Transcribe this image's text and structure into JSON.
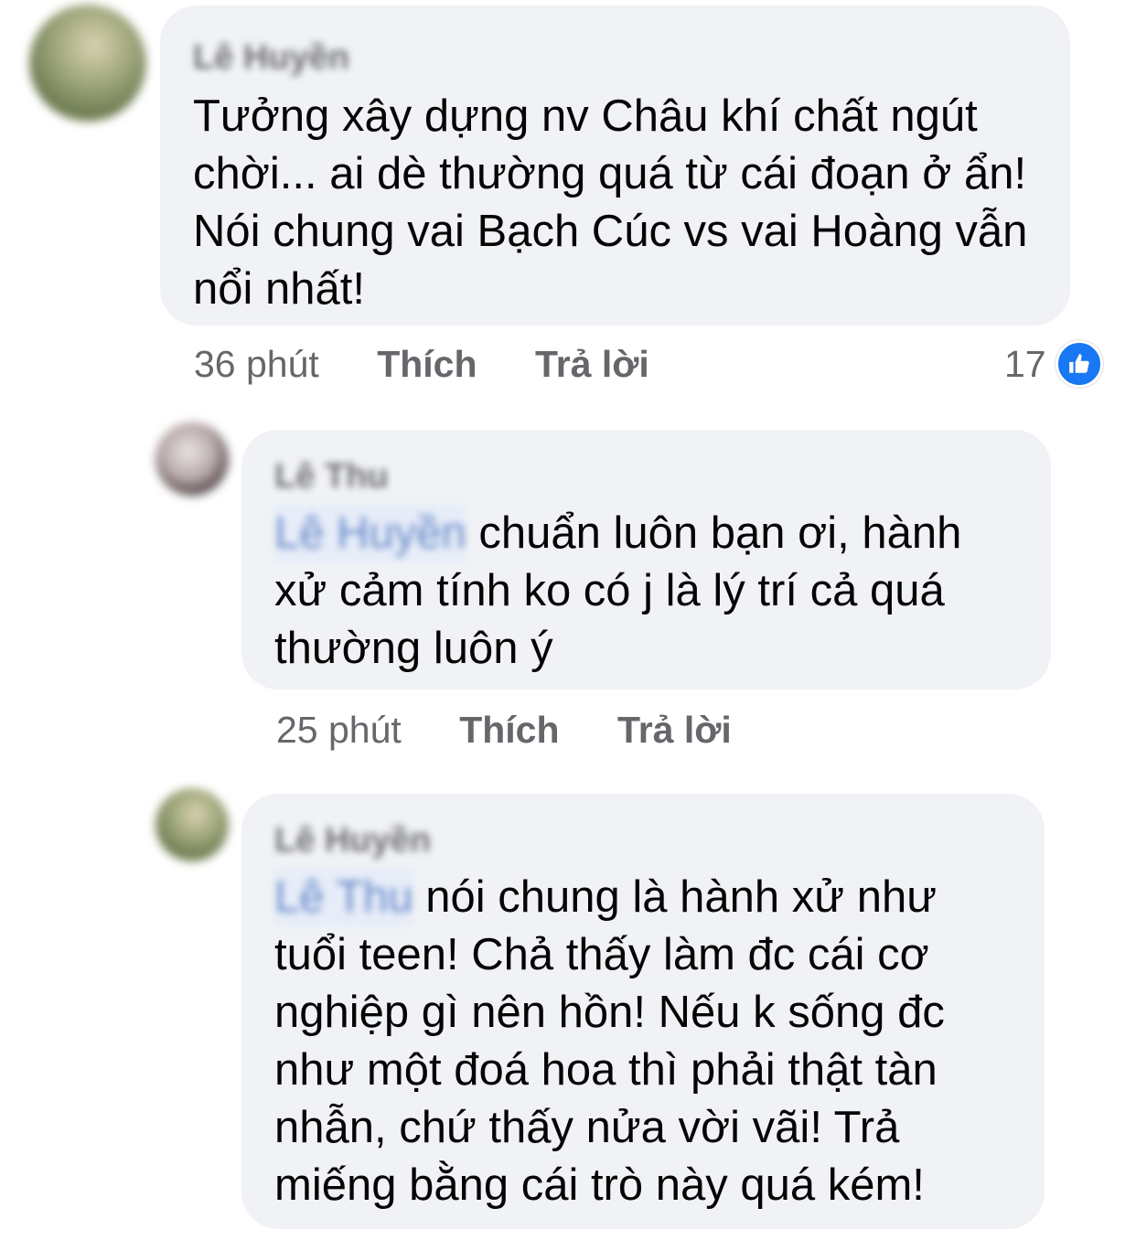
{
  "comments": [
    {
      "author": "Lê Huyền",
      "mention": "",
      "text": "Tưởng xây dựng nv Châu khí chất ngút chời... ai dè thường quá từ cái đoạn ở ẩn! Nói chung vai Bạch Cúc vs vai Hoàng vẫn nổi nhất!",
      "time": "36 phút",
      "like_label": "Thích",
      "reply_label": "Trả lời",
      "reactions": "17"
    },
    {
      "author": "Lê Thu",
      "mention": "Lê Huyền",
      "text": "chuẩn luôn bạn ơi, hành xử cảm tính ko có j là lý trí cả quá thường luôn ý",
      "time": "25 phút",
      "like_label": "Thích",
      "reply_label": "Trả lời"
    },
    {
      "author": "Lê Huyền",
      "mention": "Lê Thu",
      "text": "nói chung là hành xử như tuổi teen! Chả thấy làm đc cái cơ nghiệp gì nên hồn! Nếu k sống đc như một đoá hoa thì phải thật tàn nhẫn, chứ thấy  nửa vời vãi! Trả miếng bằng cái trò này quá kém!"
    }
  ],
  "colors": {
    "bubble": "#f0f2f5",
    "meta_text": "#65676b",
    "like_blue": "#1877f2",
    "mention_blue": "#2d5db7"
  },
  "icons": [
    "like-icon"
  ]
}
